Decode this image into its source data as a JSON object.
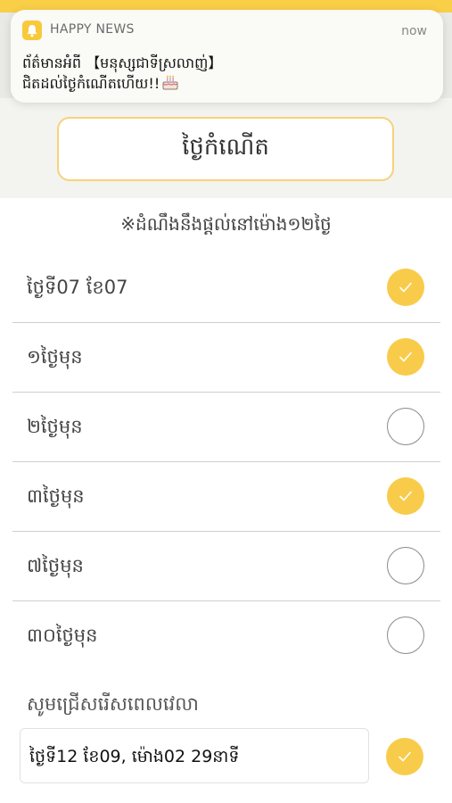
{
  "notification": {
    "app_name": "HAPPY NEWS",
    "time": "now",
    "line1": "ព័ត៌មានអំពី 【មនុស្សជាទីស្រលាញ់】",
    "line2": "ជិតដល់ថ្ងៃកំណើតហើយ!!",
    "emoji": "birthday-cake-icon"
  },
  "birthday_button": {
    "label": "ថ្ងៃកំណើត"
  },
  "note": "※ដំណឹងនឹងផ្តល់នៅម៉ោង១២ថ្ងៃ",
  "reminders": [
    {
      "label": "ថ្ងៃទី07 ខែ07",
      "checked": true
    },
    {
      "label": "១ថ្ងៃមុន",
      "checked": true
    },
    {
      "label": "២ថ្ងៃមុន",
      "checked": false
    },
    {
      "label": "៣ថ្ងៃមុន",
      "checked": true
    },
    {
      "label": "៧ថ្ងៃមុន",
      "checked": false
    },
    {
      "label": "៣០ថ្ងៃមុន",
      "checked": false
    }
  ],
  "time_select": {
    "heading": "សូមជ្រើសរើសពេលវេលា",
    "value": "ថ្ងៃទី12 ខែ09, ម៉ោង02 29នាទី",
    "checked": true
  },
  "colors": {
    "accent": "#f8cc4a",
    "button_border": "#f6d37a",
    "background_band": "#f3f3f0",
    "divider": "#cfcfcf"
  }
}
